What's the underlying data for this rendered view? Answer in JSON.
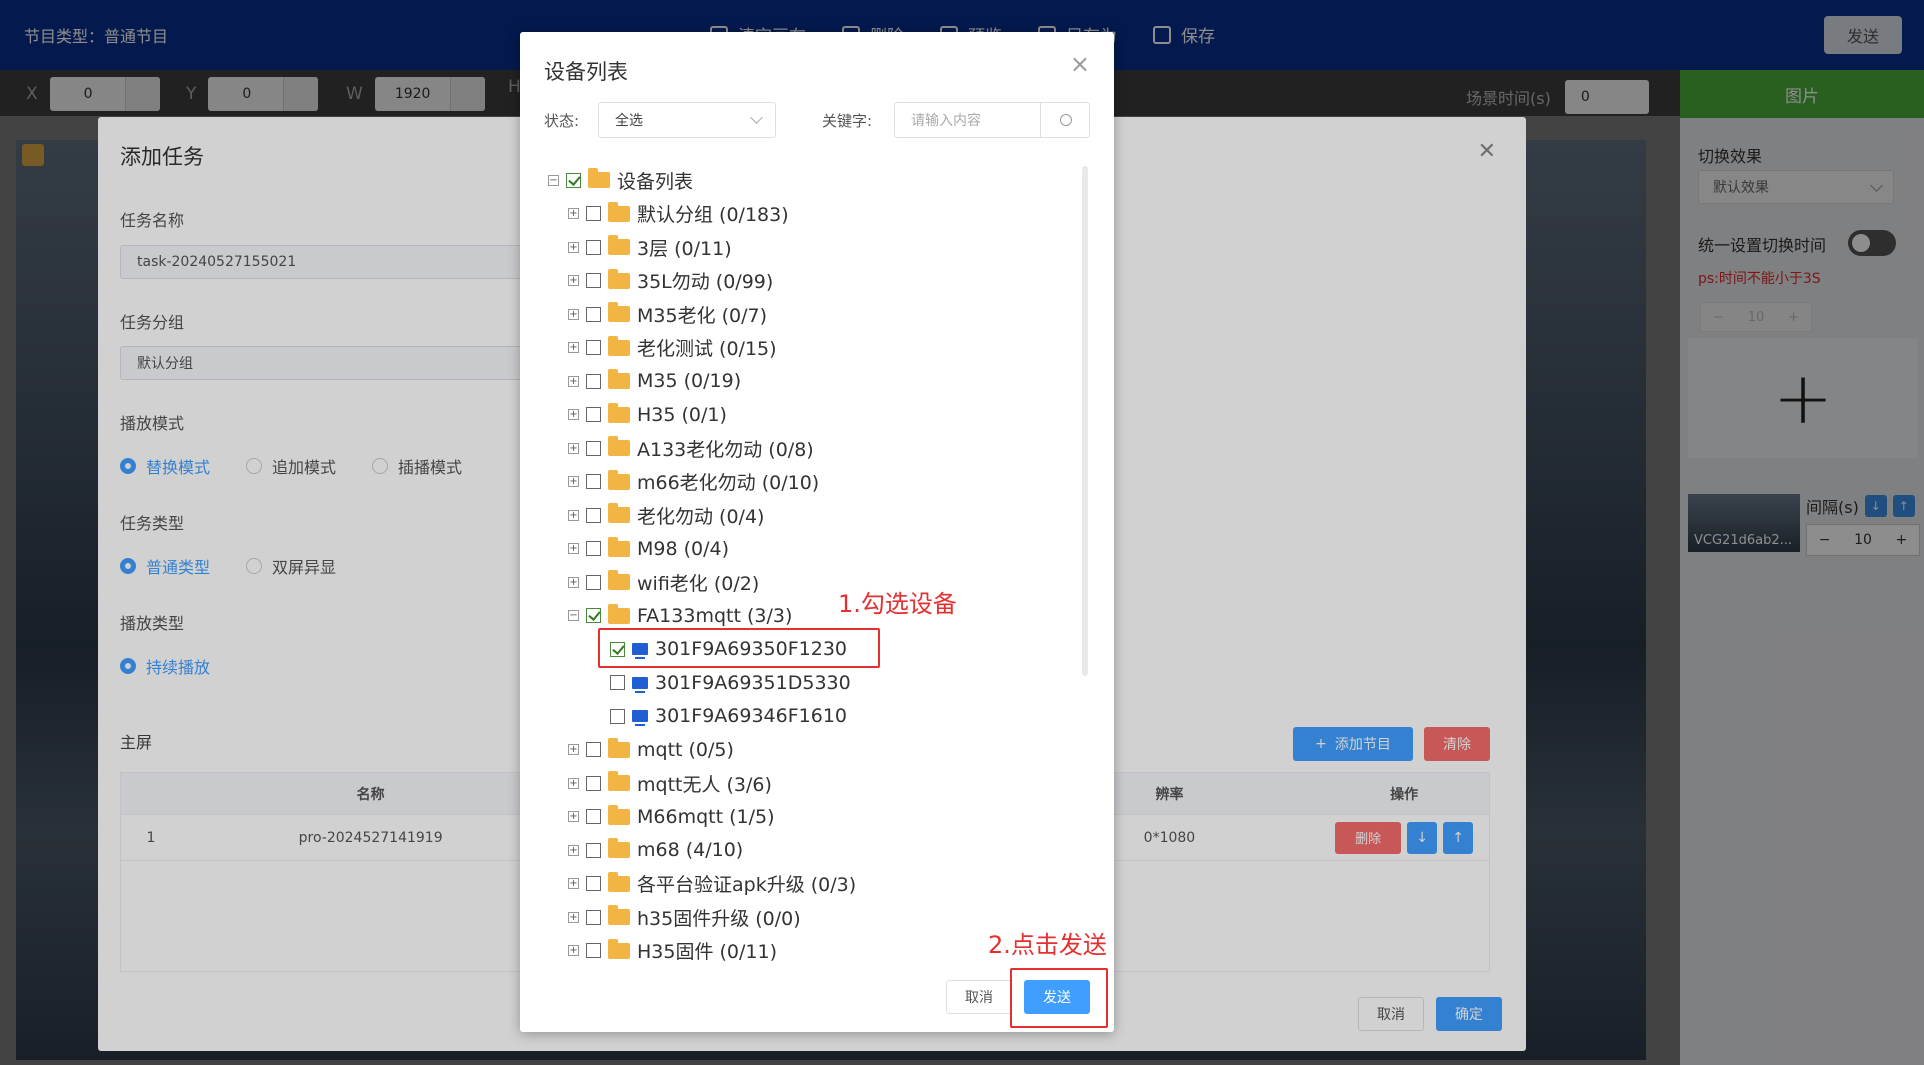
{
  "header": {
    "program_type": "节目类型：普通节目",
    "toolbar": [
      {
        "label": "清空画布",
        "icon": "rocket-icon"
      },
      {
        "label": "删除",
        "icon": "trash-icon"
      },
      {
        "label": "预览",
        "icon": "preview-icon"
      },
      {
        "label": "另存为",
        "icon": "save-as-icon"
      },
      {
        "label": "保存",
        "icon": "save-icon"
      }
    ],
    "send_label": "发送"
  },
  "propbar": {
    "x_label": "X",
    "x_value": "0",
    "y_label": "Y",
    "y_value": "0",
    "w_label": "W",
    "w_value": "1920",
    "h_label": "H",
    "scene_time_label": "场景时间(s)",
    "scene_time_value": "0"
  },
  "right_panel": {
    "tab": "图片",
    "switch_effect_label": "切换效果",
    "switch_effect_value": "默认效果",
    "unified_time_label": "统一设置切换时间",
    "warning": "ps:时间不能小于3S",
    "switch_time_value": "10",
    "add_symbol": "+",
    "thumb_name": "VCG21d6ab2...",
    "interval_label": "间隔(s)",
    "interval_value": "10"
  },
  "task_dialog": {
    "title": "添加任务",
    "task_name_label": "任务名称",
    "task_name_value": "task-20240527155021",
    "task_group_label": "任务分组",
    "task_group_value": "默认分组",
    "play_mode_label": "播放模式",
    "play_modes": [
      "替换模式",
      "追加模式",
      "插播模式"
    ],
    "task_type_label": "任务类型",
    "task_types": [
      "普通类型",
      "双屏异显"
    ],
    "play_type_label": "播放类型",
    "play_types": [
      "持续播放"
    ],
    "main_screen_label": "主屏",
    "add_program_label": "添加节目",
    "clear_label": "清除",
    "table_headers": [
      "",
      "名称",
      "",
      "辨率",
      "操作"
    ],
    "rows": [
      {
        "index": "1",
        "name": "pro-2024527141919",
        "resolution": "0*1080",
        "delete": "删除"
      }
    ],
    "cancel_label": "取消",
    "ok_label": "确定"
  },
  "device_dialog": {
    "title": "设备列表",
    "status_label": "状态:",
    "status_value": "全选",
    "keyword_label": "关键字:",
    "keyword_placeholder": "请输入内容",
    "root": "设备列表",
    "groups": [
      "默认分组 (0/183)",
      "3层 (0/11)",
      "35L勿动 (0/99)",
      "M35老化 (0/7)",
      "老化测试 (0/15)",
      "M35 (0/19)",
      "H35 (0/1)",
      "A133老化勿动 (0/8)",
      "m66老化勿动 (0/10)",
      "老化勿动 (0/4)",
      "M98 (0/4)",
      "wifi老化 (0/2)",
      "FA133mqtt (3/3)"
    ],
    "devices": [
      "301F9A69350F1230",
      "301F9A69351D5330",
      "301F9A69346F1610"
    ],
    "groups_after": [
      "mqtt (0/5)",
      "mqtt无人 (3/6)",
      "M66mqtt (1/5)",
      "m68 (4/10)",
      "各平台验证apk升级 (0/3)",
      "h35固件升级 (0/0)",
      "H35固件 (0/11)"
    ],
    "annotation_1": "1.勾选设备",
    "annotation_2": "2.点击发送",
    "cancel_label": "取消",
    "send_label": "发送"
  }
}
